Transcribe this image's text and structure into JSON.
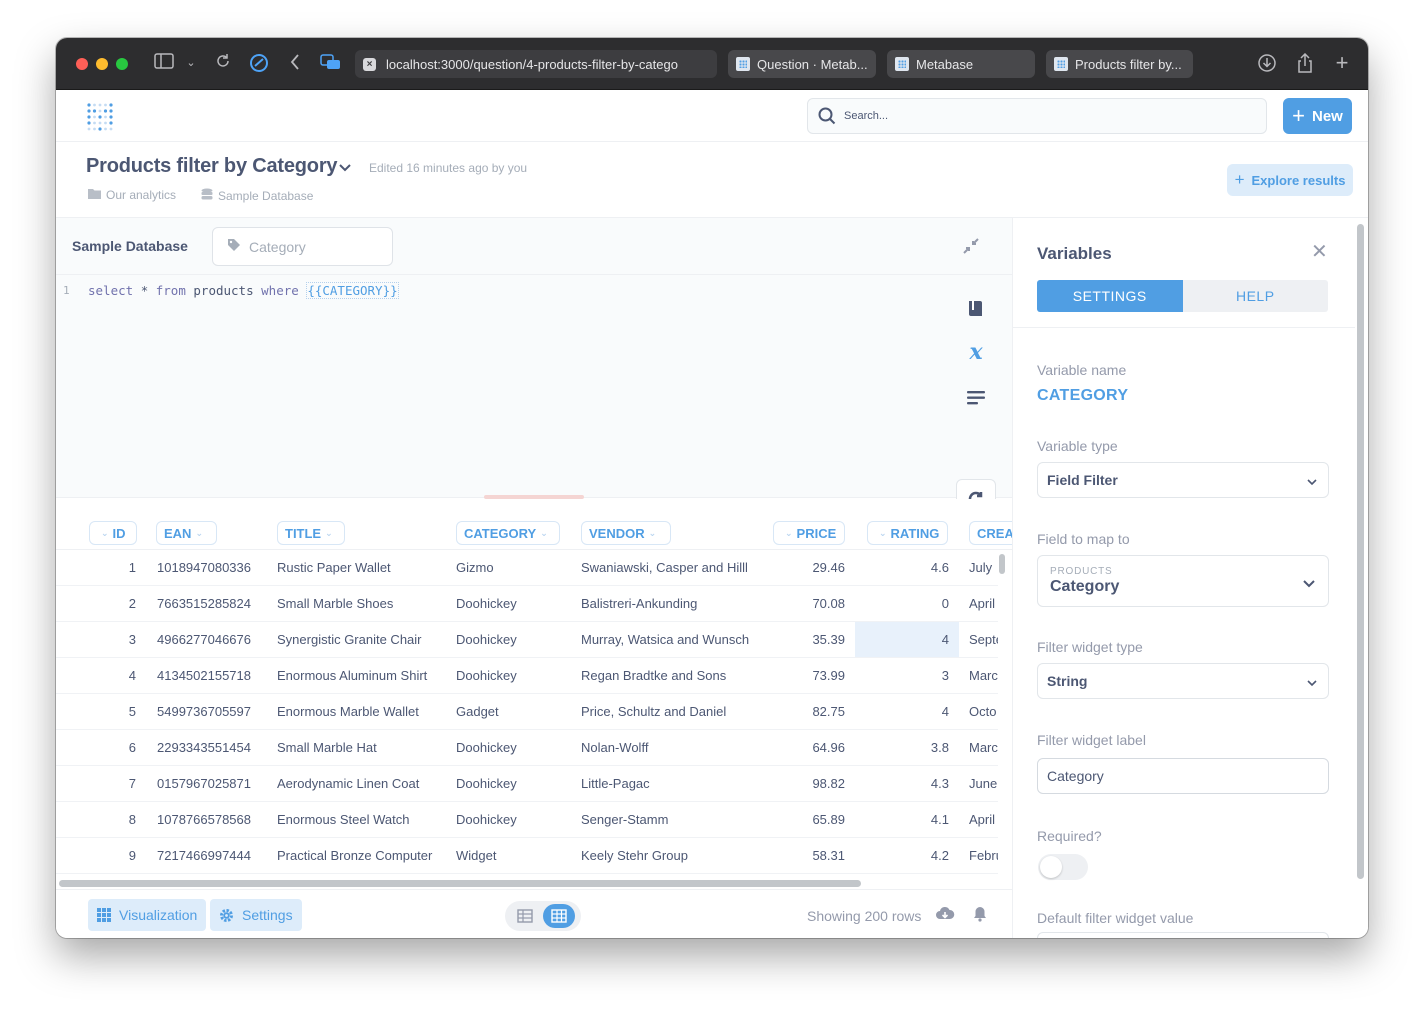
{
  "browser": {
    "url": "localhost:3000/question/4-products-filter-by-catego",
    "tabs": [
      {
        "label": "Question · Metab..."
      },
      {
        "label": "Metabase"
      },
      {
        "label": "Products filter by..."
      }
    ]
  },
  "header": {
    "search_placeholder": "Search...",
    "new_label": "New"
  },
  "question": {
    "title": "Products filter by Category",
    "edited": "Edited 16 minutes ago by you",
    "collection": "Our analytics",
    "database": "Sample Database",
    "explore_label": "Explore results"
  },
  "editor": {
    "database": "Sample Database",
    "variable_chip": "Category",
    "line_number": "1",
    "code_keywords": [
      "select",
      "from",
      "where"
    ],
    "code_star": "*",
    "code_table": "products",
    "code_variable": "{{CATEGORY}}"
  },
  "table": {
    "columns": [
      "ID",
      "EAN",
      "TITLE",
      "CATEGORY",
      "VENDOR",
      "PRICE",
      "RATING",
      "CREA"
    ],
    "rows": [
      {
        "id": "1",
        "ean": "1018947080336",
        "title": "Rustic Paper Wallet",
        "category": "Gizmo",
        "vendor": "Swaniawski, Casper and Hilll",
        "price": "29.46",
        "rating": "4.6",
        "created": "July"
      },
      {
        "id": "2",
        "ean": "7663515285824",
        "title": "Small Marble Shoes",
        "category": "Doohickey",
        "vendor": "Balistreri-Ankunding",
        "price": "70.08",
        "rating": "0",
        "created": "April"
      },
      {
        "id": "3",
        "ean": "4966277046676",
        "title": "Synergistic Granite Chair",
        "category": "Doohickey",
        "vendor": "Murray, Watsica and Wunsch",
        "price": "35.39",
        "rating": "4",
        "created": "Septe"
      },
      {
        "id": "4",
        "ean": "4134502155718",
        "title": "Enormous Aluminum Shirt",
        "category": "Doohickey",
        "vendor": "Regan Bradtke and Sons",
        "price": "73.99",
        "rating": "3",
        "created": "Marc"
      },
      {
        "id": "5",
        "ean": "5499736705597",
        "title": "Enormous Marble Wallet",
        "category": "Gadget",
        "vendor": "Price, Schultz and Daniel",
        "price": "82.75",
        "rating": "4",
        "created": "Octo"
      },
      {
        "id": "6",
        "ean": "2293343551454",
        "title": "Small Marble Hat",
        "category": "Doohickey",
        "vendor": "Nolan-Wolff",
        "price": "64.96",
        "rating": "3.8",
        "created": "Marc"
      },
      {
        "id": "7",
        "ean": "0157967025871",
        "title": "Aerodynamic Linen Coat",
        "category": "Doohickey",
        "vendor": "Little-Pagac",
        "price": "98.82",
        "rating": "4.3",
        "created": "June"
      },
      {
        "id": "8",
        "ean": "1078766578568",
        "title": "Enormous Steel Watch",
        "category": "Doohickey",
        "vendor": "Senger-Stamm",
        "price": "65.89",
        "rating": "4.1",
        "created": "April"
      },
      {
        "id": "9",
        "ean": "7217466997444",
        "title": "Practical Bronze Computer",
        "category": "Widget",
        "vendor": "Keely Stehr Group",
        "price": "58.31",
        "rating": "4.2",
        "created": "Febru"
      }
    ]
  },
  "footer": {
    "visualization_label": "Visualization",
    "settings_label": "Settings",
    "rows_text": "Showing 200 rows"
  },
  "variables_panel": {
    "title": "Variables",
    "tab_settings": "SETTINGS",
    "tab_help": "HELP",
    "variable_name_label": "Variable name",
    "variable_name": "CATEGORY",
    "variable_type_label": "Variable type",
    "variable_type": "Field Filter",
    "field_map_label": "Field to map to",
    "field_map_table": "PRODUCTS",
    "field_map_column": "Category",
    "widget_type_label": "Filter widget type",
    "widget_type": "String",
    "widget_label_label": "Filter widget label",
    "widget_label": "Category",
    "required_label": "Required?",
    "default_label": "Default filter widget value"
  },
  "colors": {
    "brand": "#509ee3",
    "text": "#4c5773",
    "muted": "#a5adb8"
  }
}
